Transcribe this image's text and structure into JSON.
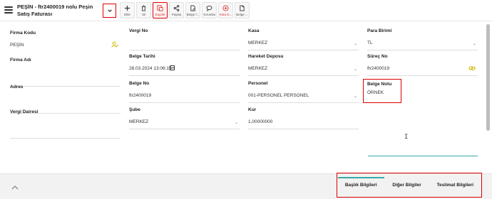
{
  "header": {
    "title": "PEŞİN - ftr2400019 nolu Peşin Satış Faturası"
  },
  "toolbar": {
    "buttons": [
      {
        "label": "Ekle",
        "icon": "plus-icon"
      },
      {
        "label": "Sil",
        "icon": "trash-icon"
      },
      {
        "label": "Kaydet",
        "icon": "save-icon"
      },
      {
        "label": "Paylaş",
        "icon": "share-icon"
      },
      {
        "label": "Belge İ...",
        "icon": "document-icon"
      },
      {
        "label": "Yorumlar",
        "icon": "comment-icon"
      },
      {
        "label": "Kötü D...",
        "icon": "cancel-icon"
      },
      {
        "label": "Belge ...",
        "icon": "file-icon"
      }
    ]
  },
  "form": {
    "col1": {
      "firma_kodu": {
        "label": "Firma Kodu",
        "value": "PEŞİN"
      },
      "firma_adi": {
        "label": "Firma Adı",
        "value": ""
      },
      "adres": {
        "label": "Adres",
        "value": ""
      },
      "vergi_dairesi": {
        "label": "Vergi Dairesi",
        "value": ""
      }
    },
    "col2": {
      "vergi_no": {
        "label": "Vergi No",
        "value": ""
      },
      "belge_tarihi": {
        "label": "Belge Tarihi",
        "value": "28.03.2024 13:06:15"
      },
      "belge_no": {
        "label": "Belge No",
        "value": "ftr2400019"
      },
      "sube": {
        "label": "Şube",
        "value": "MERKEZ"
      }
    },
    "col3": {
      "kasa": {
        "label": "Kasa",
        "value": "MERKEZ"
      },
      "hareket_deposu": {
        "label": "Hareket Deposu",
        "value": "MERKEZ"
      },
      "personel": {
        "label": "Personel",
        "value": "001-PERSONEL PERSONEL"
      },
      "kur": {
        "label": "Kur",
        "value": "1,00000000"
      }
    },
    "col4": {
      "para_birimi": {
        "label": "Para Birimi",
        "value": "TL"
      },
      "surec_no": {
        "label": "Süreç No",
        "value": "ftr2400019"
      },
      "belge_notu": {
        "label": "Belge Notu",
        "value": "ÖRNEK"
      }
    }
  },
  "footer": {
    "tabs": [
      "Başlık Bilgileri",
      "Diğer Bilgiler",
      "Teslimat Bilgileri"
    ]
  },
  "colors": {
    "accent": "#3aa8a8",
    "highlight": "#dd0000",
    "yellow_icon": "#c9b800"
  }
}
